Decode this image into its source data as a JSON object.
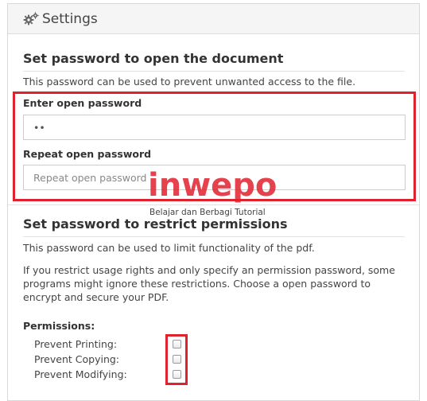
{
  "panel": {
    "title": "Settings",
    "icon": "gears-icon"
  },
  "open_section": {
    "heading": "Set password to open the document",
    "description": "This password can be used to prevent unwanted access to the file.",
    "enter_label": "Enter open password",
    "enter_value": "••",
    "repeat_label": "Repeat open password",
    "repeat_placeholder": "Repeat open password"
  },
  "restrict_section": {
    "heading": "Set password to restrict permissions",
    "description1": "This password can be used to limit functionality of the pdf.",
    "description2_lines": [
      "If you restrict usage rights and only specify an permission password, some",
      "programs might ignore these restrictions. Choose a open password to",
      "encrypt and secure your PDF."
    ],
    "permissions_label": "Permissions:",
    "permissions": [
      {
        "label": "Prevent Printing:",
        "checked": false
      },
      {
        "label": "Prevent Copying:",
        "checked": false
      },
      {
        "label": "Prevent Modifying:",
        "checked": false
      }
    ]
  },
  "watermark": {
    "brand": "inwepo",
    "tagline": "Belajar dan Berbagi Tutorial"
  },
  "colors": {
    "highlight": "#e0212e",
    "header_bg": "#f5f5f5"
  }
}
